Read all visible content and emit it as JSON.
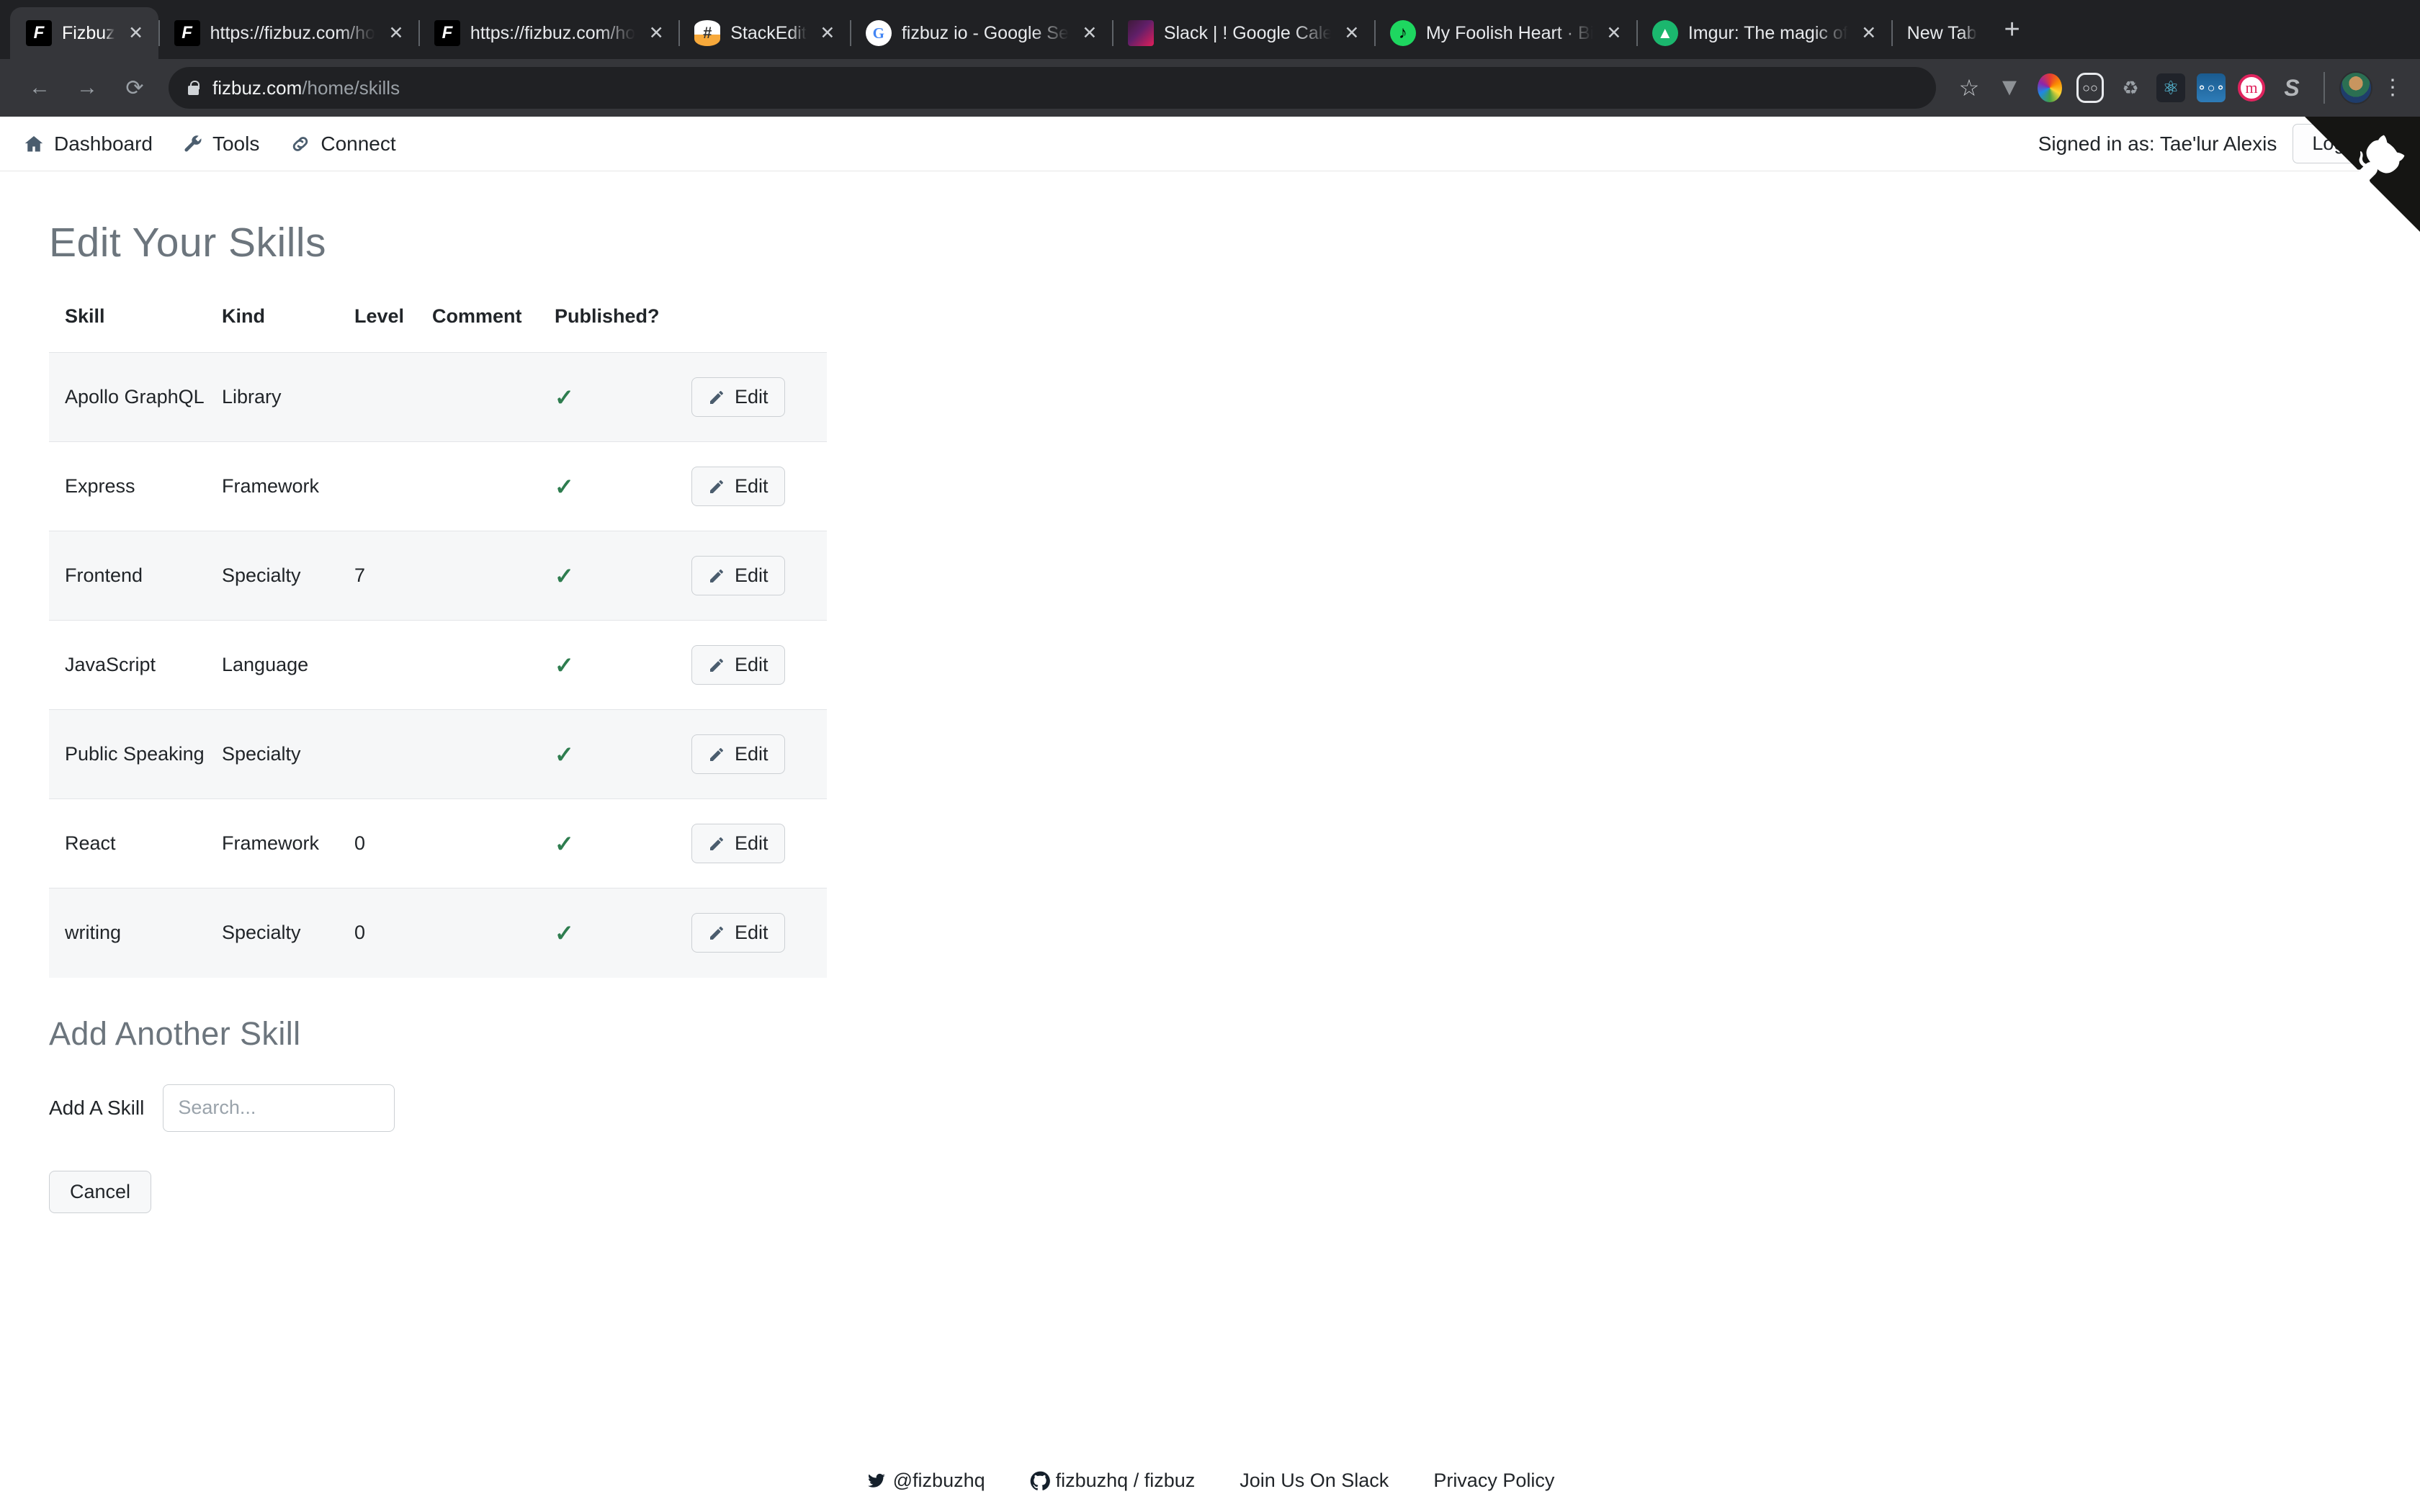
{
  "browser": {
    "tabs": [
      {
        "title": "Fizbuz",
        "favicon": "fizbuz-icon",
        "active": true,
        "closable": true
      },
      {
        "title": "https://fizbuz.com/ho",
        "favicon": "fizbuz-icon",
        "active": false,
        "closable": true
      },
      {
        "title": "https://fizbuz.com/ho",
        "favicon": "fizbuz-icon",
        "active": false,
        "closable": true
      },
      {
        "title": "StackEdit",
        "favicon": "stackedit-icon",
        "active": false,
        "closable": true
      },
      {
        "title": "fizbuz io - Google Se",
        "favicon": "google-icon",
        "active": false,
        "closable": true
      },
      {
        "title": "Slack | ! Google Cale",
        "favicon": "slack-icon",
        "active": false,
        "closable": true
      },
      {
        "title": "My Foolish Heart · Bi",
        "favicon": "spotify-icon",
        "active": false,
        "closable": true
      },
      {
        "title": "Imgur: The magic of",
        "favicon": "imgur-icon",
        "active": false,
        "closable": true
      },
      {
        "title": "New Tab",
        "favicon": "none",
        "active": false,
        "closable": false
      }
    ],
    "new_tab_label": "+",
    "close_glyph": "✕",
    "nav": {
      "back": "←",
      "forward": "→",
      "reload": "⟳"
    },
    "omnibox": {
      "domain": "fizbuz.com",
      "path": "/home/skills",
      "lock": "lock-icon"
    },
    "extensions": [
      "star-icon",
      "vue-extension-icon",
      "color-picker-extension-icon",
      "mask-extension-icon",
      "recycle-extension-icon",
      "react-devtools-icon",
      "nextcloud-extension-icon",
      "mendeley-extension-icon",
      "skype-extension-icon"
    ],
    "profile_avatar": "avatar",
    "menu": "kebab-menu-icon"
  },
  "navbar": {
    "items": [
      {
        "label": "Dashboard",
        "icon": "home-icon"
      },
      {
        "label": "Tools",
        "icon": "wrench-icon"
      },
      {
        "label": "Connect",
        "icon": "link-icon"
      }
    ],
    "signed_in_text": "Signed in as: Tae'lur Alexis",
    "logout_label": "Logout"
  },
  "github_corner": {
    "icon": "github-octocat-icon",
    "color": "#151513"
  },
  "page": {
    "title": "Edit Your Skills",
    "table": {
      "columns": [
        "Skill",
        "Kind",
        "Level",
        "Comment",
        "Published?"
      ],
      "rows": [
        {
          "skill": "Apollo GraphQL",
          "kind": "Library",
          "level": "",
          "comment": "",
          "published": "✓",
          "action": "Edit"
        },
        {
          "skill": "Express",
          "kind": "Framework",
          "level": "",
          "comment": "",
          "published": "✓",
          "action": "Edit"
        },
        {
          "skill": "Frontend",
          "kind": "Specialty",
          "level": "7",
          "comment": "",
          "published": "✓",
          "action": "Edit"
        },
        {
          "skill": "JavaScript",
          "kind": "Language",
          "level": "",
          "comment": "",
          "published": "✓",
          "action": "Edit"
        },
        {
          "skill": "Public Speaking",
          "kind": "Specialty",
          "level": "",
          "comment": "",
          "published": "✓",
          "action": "Edit"
        },
        {
          "skill": "React",
          "kind": "Framework",
          "level": "0",
          "comment": "",
          "published": "✓",
          "action": "Edit"
        },
        {
          "skill": "writing",
          "kind": "Specialty",
          "level": "0",
          "comment": "",
          "published": "✓",
          "action": "Edit"
        }
      ],
      "edit_icon": "pencil-icon",
      "check_color": "#2e7d4f"
    },
    "add_section": {
      "heading": "Add Another Skill",
      "field_label": "Add A Skill",
      "field_value": "",
      "field_placeholder": "Search...",
      "cancel_label": "Cancel"
    }
  },
  "footer": {
    "links": [
      {
        "label": "@fizbuzhq",
        "icon": "twitter-icon"
      },
      {
        "label": "fizbuzhq / fizbuz",
        "icon": "github-icon"
      },
      {
        "label": "Join Us On Slack",
        "icon": "none"
      },
      {
        "label": "Privacy Policy",
        "icon": "none"
      }
    ]
  }
}
